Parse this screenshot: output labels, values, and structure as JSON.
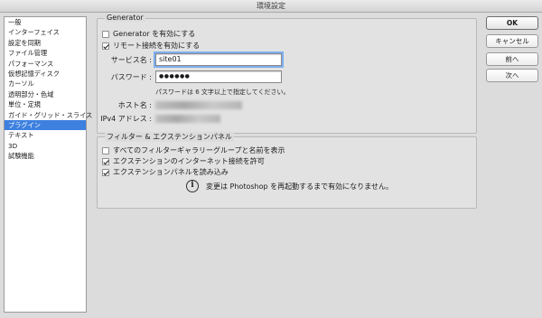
{
  "window": {
    "title": "環境設定"
  },
  "sidebar": {
    "items": [
      {
        "label": "一般",
        "selected": false
      },
      {
        "label": "インターフェイス",
        "selected": false
      },
      {
        "label": "設定を同期",
        "selected": false
      },
      {
        "label": "ファイル管理",
        "selected": false
      },
      {
        "label": "パフォーマンス",
        "selected": false
      },
      {
        "label": "仮想記憶ディスク",
        "selected": false
      },
      {
        "label": "カーソル",
        "selected": false
      },
      {
        "label": "透明部分・色域",
        "selected": false
      },
      {
        "label": "単位・定規",
        "selected": false
      },
      {
        "label": "ガイド・グリッド・スライス",
        "selected": false
      },
      {
        "label": "プラグイン",
        "selected": true
      },
      {
        "label": "テキスト",
        "selected": false
      },
      {
        "label": "3D",
        "selected": false
      },
      {
        "label": "試験機能",
        "selected": false
      }
    ]
  },
  "generator": {
    "title": "Generator",
    "enable_label": "Generator を有効にする",
    "enable_checked": false,
    "remote_label": "リモート接続を有効にする",
    "remote_checked": true,
    "service_name_label": "サービス名 :",
    "service_name_value": "site01",
    "password_label": "パスワード :",
    "password_value": "●●●●●●",
    "password_hint": "パスワードは 6 文字以上で指定してください。",
    "host_label": "ホスト名 :",
    "ipv4_label": "IPv4 アドレス :"
  },
  "plugins": {
    "title": "フィルター & エクステンションパネル",
    "show_all_label": "すべてのフィルターギャラリーグループと名前を表示",
    "show_all_checked": false,
    "allow_internet_label": "エクステンションのインターネット接続を許可",
    "allow_internet_checked": true,
    "load_panels_label": "エクステンションパネルを読み込み",
    "load_panels_checked": true,
    "restart_notice": "変更は Photoshop を再起動するまで有効になりません。"
  },
  "buttons": {
    "ok": "OK",
    "cancel": "キャンセル",
    "prev": "前へ",
    "next": "次へ"
  }
}
